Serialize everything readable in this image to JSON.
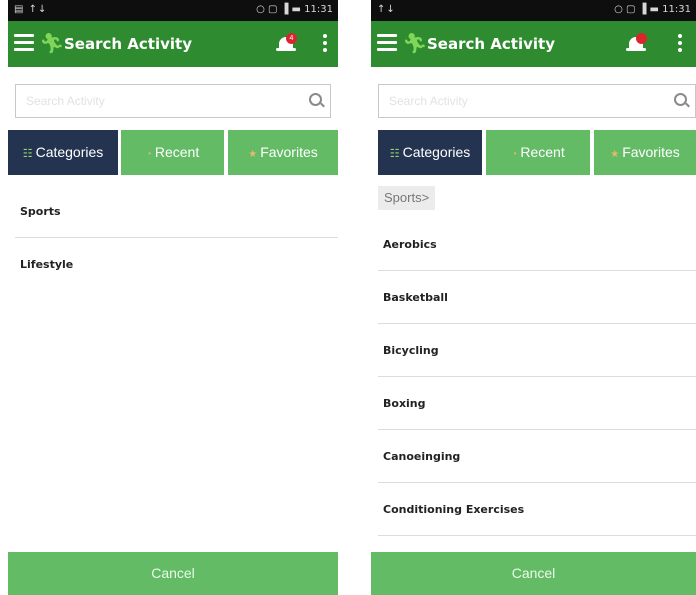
{
  "left": {
    "status_bar": {
      "left": "▤ ↑↓",
      "right": "○ ▢ ▐ ▬ 11:31"
    },
    "app_bar": {
      "title": "Search Activity",
      "notification_count": "4"
    },
    "search": {
      "placeholder": "Search Activity"
    },
    "tabs": [
      {
        "label": "Categories",
        "icon": "sitemap-icon",
        "active": true
      },
      {
        "label": "Recent",
        "icon": "clock-icon",
        "active": false
      },
      {
        "label": "Favorites",
        "icon": "star-icon",
        "active": false
      }
    ],
    "items": [
      "Sports",
      "Lifestyle"
    ],
    "cancel_label": "Cancel"
  },
  "right": {
    "status_bar": {
      "left": "↑↓",
      "right": "○ ▢ ▐ ▬ 11:31"
    },
    "app_bar": {
      "title": "Search Activity",
      "notification_count": ""
    },
    "search": {
      "placeholder": "Search Activity"
    },
    "tabs": [
      {
        "label": "Categories",
        "icon": "sitemap-icon",
        "active": true
      },
      {
        "label": "Recent",
        "icon": "clock-icon",
        "active": false
      },
      {
        "label": "Favorites",
        "icon": "star-icon",
        "active": false
      }
    ],
    "breadcrumb": "Sports>",
    "items": [
      "Aerobics",
      "Basketball",
      "Bicycling",
      "Boxing",
      "Canoeinging",
      "Conditioning Exercises"
    ],
    "cancel_label": "Cancel"
  },
  "colors": {
    "app_bar": "#2e8b30",
    "tab_active": "#24334f",
    "tab_inactive": "#63bb66",
    "badge": "#d9262e",
    "cancel_bar": "#63bb66"
  }
}
